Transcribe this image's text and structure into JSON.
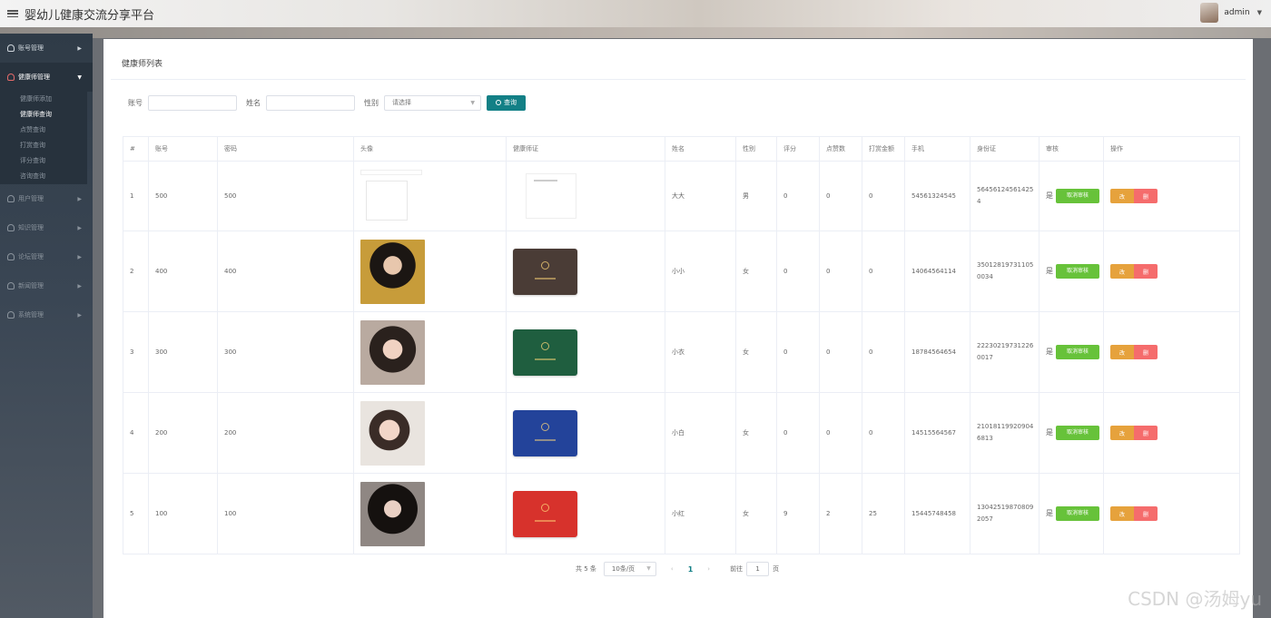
{
  "header": {
    "title": "婴幼儿健康交流分享平台",
    "username": "admin"
  },
  "sidebar": {
    "items": [
      {
        "label": "账号管理"
      },
      {
        "label": "健康师管理",
        "active": true
      },
      {
        "label": "用户管理"
      },
      {
        "label": "知识管理"
      },
      {
        "label": "论坛管理"
      },
      {
        "label": "新闻管理"
      },
      {
        "label": "系统管理"
      }
    ],
    "submenu": [
      "健康师添加",
      "健康师查询",
      "点赞查询",
      "打赏查询",
      "评分查询",
      "咨询查询"
    ]
  },
  "panel": {
    "title": "健康师列表"
  },
  "filters": {
    "account_label": "账号",
    "name_label": "姓名",
    "gender_label": "性别",
    "gender_placeholder": "请选择",
    "search_label": "查询"
  },
  "table": {
    "headers": [
      "#",
      "账号",
      "密码",
      "头像",
      "健康师证",
      "姓名",
      "性别",
      "评分",
      "点赞数",
      "打赏金额",
      "手机",
      "身份证",
      "审核",
      "操作"
    ],
    "audit_button": "取消审核",
    "edit_button": "改",
    "delete_button": "删",
    "rows": [
      {
        "index": "1",
        "account": "500",
        "password": "500",
        "name": "大大",
        "gender": "男",
        "score": "0",
        "likes": "0",
        "reward": "0",
        "phone": "54561324545",
        "id_card": "564561245614254",
        "audit": "是"
      },
      {
        "index": "2",
        "account": "400",
        "password": "400",
        "name": "小小",
        "gender": "女",
        "score": "0",
        "likes": "0",
        "reward": "0",
        "phone": "14064564114",
        "id_card": "350128197311050034",
        "audit": "是"
      },
      {
        "index": "3",
        "account": "300",
        "password": "300",
        "name": "小衣",
        "gender": "女",
        "score": "0",
        "likes": "0",
        "reward": "0",
        "phone": "18784564654",
        "id_card": "222302197312260017",
        "audit": "是"
      },
      {
        "index": "4",
        "account": "200",
        "password": "200",
        "name": "小白",
        "gender": "女",
        "score": "0",
        "likes": "0",
        "reward": "0",
        "phone": "14515564567",
        "id_card": "210181199209046813",
        "audit": "是"
      },
      {
        "index": "5",
        "account": "100",
        "password": "100",
        "name": "小红",
        "gender": "女",
        "score": "9",
        "likes": "2",
        "reward": "25",
        "phone": "15445748458",
        "id_card": "130425198708092057",
        "audit": "是"
      }
    ]
  },
  "pagination": {
    "total_text": "共 5 条",
    "page_size": "10条/页",
    "prev": "‹",
    "current": "1",
    "next": "›",
    "goto_label": "前往",
    "goto_value": "1",
    "page_unit": "页"
  },
  "watermark": "CSDN @汤姆yu",
  "colors": {
    "primary": "#138086",
    "success": "#67c23a",
    "warning": "#e6a23c",
    "danger": "#f56c6c",
    "cert_brown": "#4a3c36",
    "cert_green": "#1f5e3f",
    "cert_blue": "#23439a",
    "cert_red": "#d7322c"
  }
}
